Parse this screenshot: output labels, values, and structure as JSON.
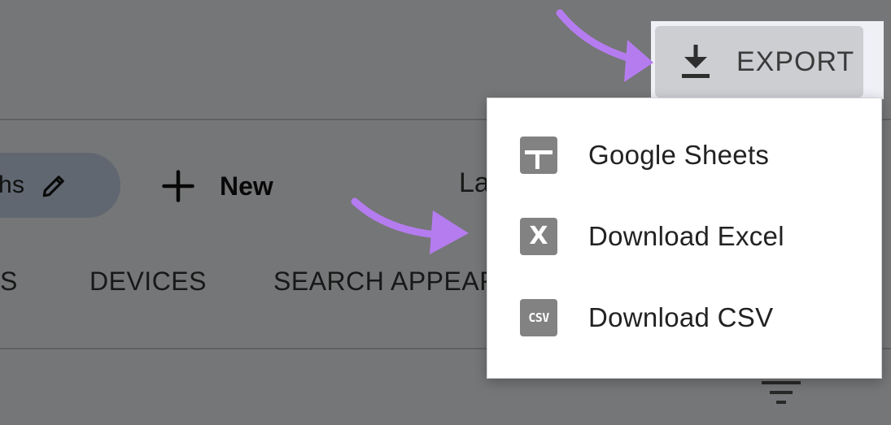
{
  "toolbar": {
    "chip_text": "hs",
    "new_label": "New",
    "label_fragment": "La"
  },
  "tabs": {
    "first_fragment": "S",
    "devices": "DEVICES",
    "search_appearance_fragment": "SEARCH APPEAR"
  },
  "export": {
    "label": "EXPORT"
  },
  "export_menu": {
    "items": [
      {
        "label": "Google Sheets",
        "icon": "google-sheets-icon"
      },
      {
        "label": "Download Excel",
        "icon": "excel-icon",
        "glyph": "X"
      },
      {
        "label": "Download CSV",
        "icon": "csv-icon",
        "glyph": "CSV"
      }
    ]
  },
  "colors": {
    "annotation_arrow": "#b57cf0",
    "chip_background": "#c9d7ec",
    "menu_icon": "#828282"
  }
}
